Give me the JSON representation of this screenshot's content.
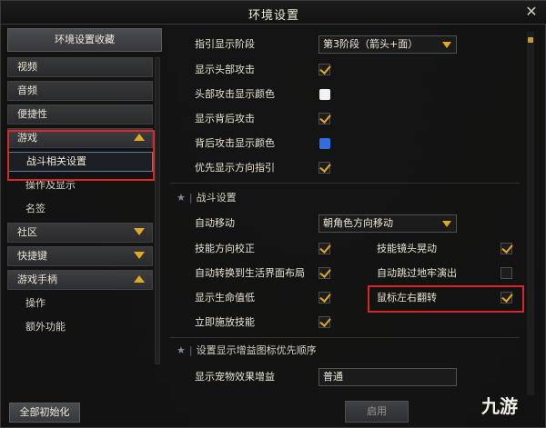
{
  "window": {
    "title": "环境设置",
    "close_icon": "close-icon"
  },
  "sidebar": {
    "favorites_label": "环境设置收藏",
    "categories": [
      {
        "label": "视频",
        "state": "none"
      },
      {
        "label": "音频",
        "state": "none"
      },
      {
        "label": "便捷性",
        "state": "none"
      },
      {
        "label": "游戏",
        "state": "open",
        "subs": [
          "战斗相关设置",
          "操作及显示",
          "名签"
        ],
        "selected": "战斗相关设置"
      },
      {
        "label": "社区",
        "state": "closed"
      },
      {
        "label": "快捷键",
        "state": "closed"
      },
      {
        "label": "游戏手柄",
        "state": "open",
        "subs": [
          "操作",
          "额外功能"
        ]
      }
    ],
    "reset_label": "全部初始化"
  },
  "settings": {
    "guide_stage": {
      "label": "指引显示阶段",
      "value": "第3阶段（箭头+面）"
    },
    "show_head_attack": {
      "label": "显示头部攻击",
      "checked": true
    },
    "head_attack_color": {
      "label": "头部攻击显示颜色",
      "color": "#f2f2f2"
    },
    "show_back_attack": {
      "label": "显示背后攻击",
      "checked": true
    },
    "back_attack_color": {
      "label": "背后攻击显示颜色",
      "color": "#2f6fe0"
    },
    "priority_direction": {
      "label": "优先显示方向指引",
      "checked": true
    }
  },
  "combat": {
    "section_title": "战斗设置",
    "auto_move": {
      "label": "自动移动",
      "value": "朝角色方向移动"
    },
    "skill_direction_fix": {
      "label": "技能方向校正",
      "checked": true
    },
    "skill_camera_shake": {
      "label": "技能镜头晃动",
      "checked": true
    },
    "auto_switch_layout": {
      "label": "自动转换到生活界面布局",
      "checked": true
    },
    "auto_skip_dungeon": {
      "label": "自动跳过地牢演出",
      "checked": false
    },
    "show_hp_low": {
      "label": "显示生命值低",
      "checked": true
    },
    "mouse_lr_flip": {
      "label": "鼠标左右翻转",
      "checked": true
    },
    "instant_cast": {
      "label": "立即施放技能",
      "checked": true
    }
  },
  "buff_priority": {
    "section_title": "设置显示增益图标优先顺序",
    "pet_buff": {
      "label": "显示宠物效果增益",
      "value": "普通"
    }
  },
  "footer": {
    "apply_label": "启用"
  },
  "branding": {
    "logo_text": "九游"
  },
  "colors": {
    "accent": "#e3a81f",
    "highlight": "#d8262a"
  }
}
